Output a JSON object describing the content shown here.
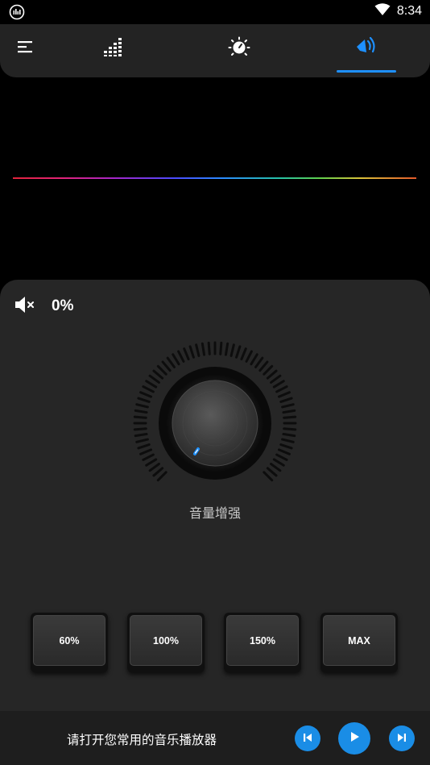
{
  "status_bar": {
    "time": "8:34",
    "left_icon": "equalizer-notification-icon",
    "wifi_icon": "wifi-icon",
    "battery_icon": "battery-icon"
  },
  "tabs": [
    {
      "name": "menu",
      "icon": "menu-icon",
      "active": false
    },
    {
      "name": "equalizer",
      "icon": "equalizer-icon",
      "active": false
    },
    {
      "name": "effects",
      "icon": "sun-dial-icon",
      "active": false
    },
    {
      "name": "volume-boost",
      "icon": "speaker-icon",
      "active": true
    }
  ],
  "colors": {
    "accent": "#1e90ff",
    "panel": "#262626",
    "background": "#000000",
    "player_button": "#1a8de6"
  },
  "volume": {
    "mute_icon": "speaker-mute-icon",
    "percent_label": "0%",
    "knob_level": 0,
    "knob_label": "音量增强"
  },
  "presets": [
    "60%",
    "100%",
    "150%",
    "MAX"
  ],
  "player": {
    "prompt": "请打开您常用的音乐播放器",
    "prev_icon": "skip-previous-icon",
    "play_icon": "play-icon",
    "next_icon": "skip-next-icon"
  }
}
